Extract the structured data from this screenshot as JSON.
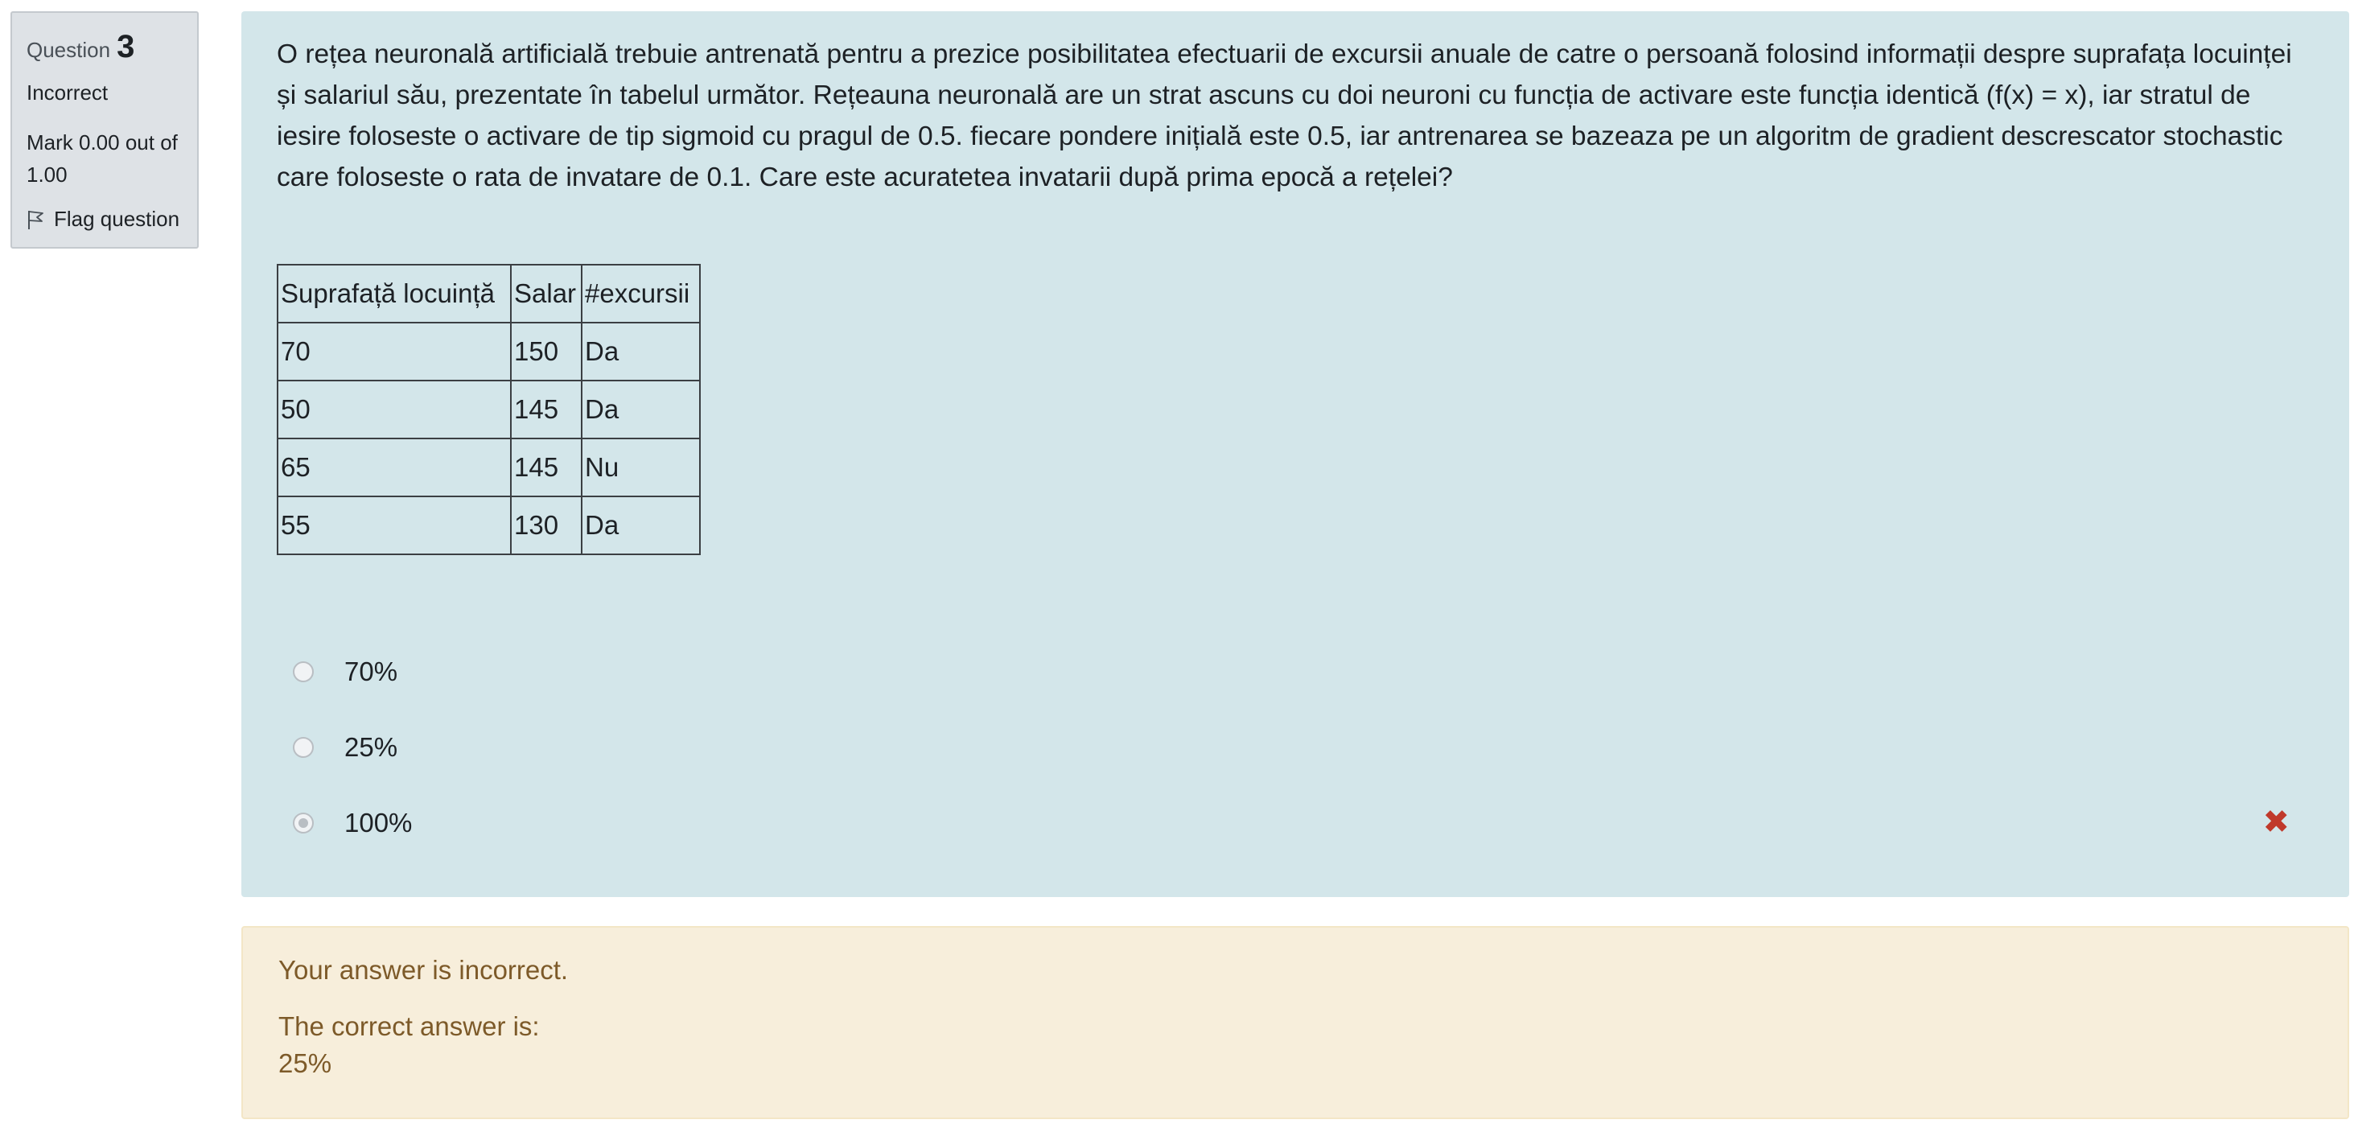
{
  "info": {
    "question_label": "Question",
    "question_number": "3",
    "state": "Incorrect",
    "grade": "Mark 0.00 out of 1.00",
    "flag_label": "Flag question"
  },
  "question": {
    "text": "O rețea neuronală artificială trebuie antrenată pentru a prezice posibilitatea efectuarii de excursii anuale de catre o persoană folosind informații despre suprafața locuinței și salariul său, prezentate în tabelul următor. Rețeauna neuronală are un strat ascuns cu doi neuroni cu funcția de activare este funcția identică (f(x) = x), iar stratul de iesire foloseste o activare de tip sigmoid cu pragul de 0.5. fiecare pondere inițială este 0.5, iar antrenarea se bazeaza pe un algoritm de gradient descrescator stochastic care foloseste o rata de invatare de 0.1. Care este acuratetea invatarii după prima epocă a rețelei?",
    "table": {
      "headers": [
        "Suprafață locuință",
        "Salar",
        "#excursii"
      ],
      "rows": [
        [
          "70",
          "150",
          "Da"
        ],
        [
          "50",
          "145",
          "Da"
        ],
        [
          "65",
          "145",
          "Nu"
        ],
        [
          "55",
          "130",
          "Da"
        ]
      ]
    },
    "answers": [
      {
        "label": "70%",
        "selected": false
      },
      {
        "label": "25%",
        "selected": false
      },
      {
        "label": "100%",
        "selected": true
      }
    ],
    "incorrect_icon": "x-mark-icon"
  },
  "outcome": {
    "feedback": "Your answer is incorrect.",
    "right_answer_label": "The correct answer is:",
    "right_answer_value": "25%"
  },
  "colors": {
    "formulation_bg": "#d3e6ea",
    "outcome_bg": "#f7eedb",
    "outcome_text": "#7d5a29",
    "incorrect": "#c0392b",
    "info_bg": "#dee2e6"
  }
}
